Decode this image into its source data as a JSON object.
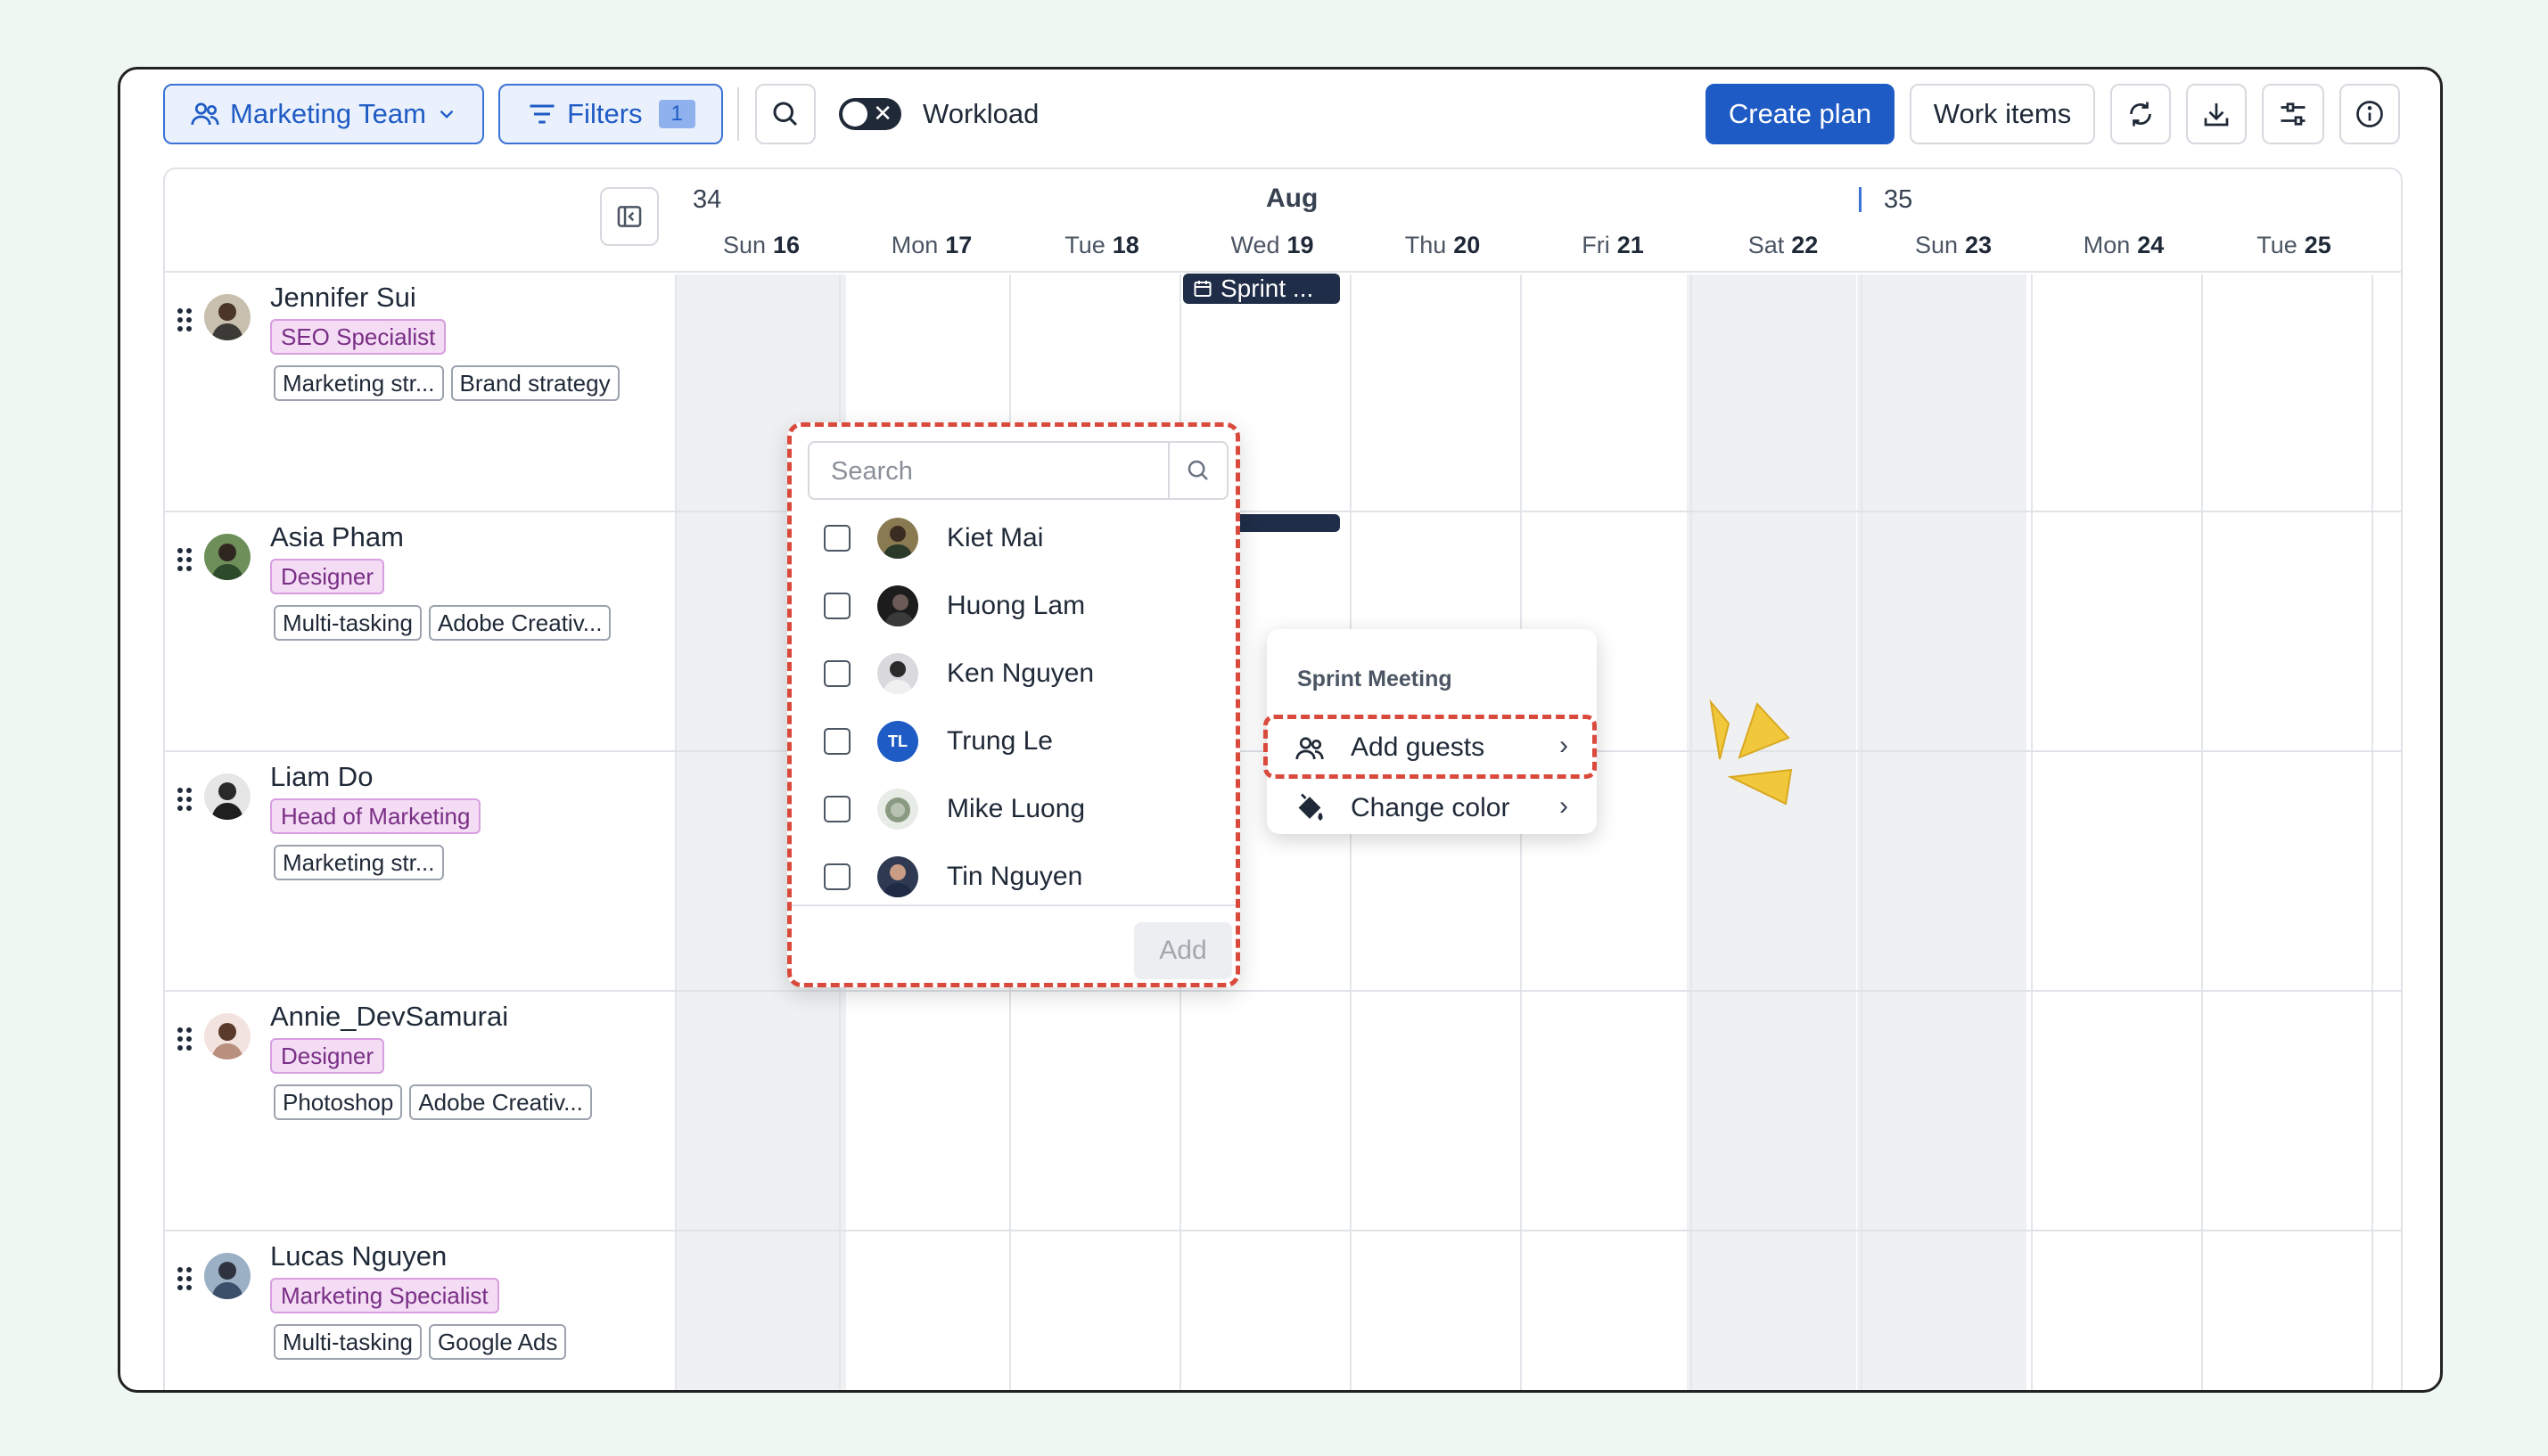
{
  "toolbar": {
    "team_label": "Marketing Team",
    "filters_label": "Filters",
    "filter_count": "1",
    "workload_label": "Workload",
    "create_label": "Create plan",
    "work_items_label": "Work items"
  },
  "calendar": {
    "week_a": "34",
    "week_b": "35",
    "month": "Aug",
    "days": [
      {
        "dow": "Sun",
        "d": "16"
      },
      {
        "dow": "Mon",
        "d": "17"
      },
      {
        "dow": "Tue",
        "d": "18"
      },
      {
        "dow": "Wed",
        "d": "19"
      },
      {
        "dow": "Thu",
        "d": "20"
      },
      {
        "dow": "Fri",
        "d": "21"
      },
      {
        "dow": "Sat",
        "d": "22"
      },
      {
        "dow": "Sun",
        "d": "23"
      },
      {
        "dow": "Mon",
        "d": "24"
      },
      {
        "dow": "Tue",
        "d": "25"
      }
    ],
    "event_label": "Sprint ..."
  },
  "people": [
    {
      "name": "Jennifer Sui",
      "role": "SEO Specialist",
      "tags": [
        "Marketing str...",
        "Brand strategy"
      ]
    },
    {
      "name": "Asia Pham",
      "role": "Designer",
      "tags": [
        "Multi-tasking",
        "Adobe Creativ..."
      ]
    },
    {
      "name": "Liam Do",
      "role": "Head of Marketing",
      "tags": [
        "Marketing str..."
      ]
    },
    {
      "name": "Annie_DevSamurai",
      "role": "Designer",
      "tags": [
        "Photoshop",
        "Adobe Creativ..."
      ]
    },
    {
      "name": "Lucas Nguyen",
      "role": "Marketing Specialist",
      "tags": [
        "Multi-tasking",
        "Google Ads"
      ]
    }
  ],
  "guest_picker": {
    "search_placeholder": "Search",
    "add_label": "Add",
    "options": [
      {
        "name": "Kiet Mai",
        "checked": false
      },
      {
        "name": "Huong Lam",
        "checked": false
      },
      {
        "name": "Ken Nguyen",
        "checked": false
      },
      {
        "name": "Trung Le",
        "checked": false,
        "initials": "TL"
      },
      {
        "name": "Mike Luong",
        "checked": false
      },
      {
        "name": "Tin Nguyen",
        "checked": false
      }
    ]
  },
  "context_menu": {
    "title": "Sprint Meeting",
    "add_guests": "Add guests",
    "change_color": "Change color"
  },
  "colors": {
    "accent": "#1f5bc4",
    "highlight": "#d94a3d",
    "role_bg": "#f3dcf4",
    "weekend": "#eef0f2",
    "event": "#1f2d48",
    "sparkle": "#f1c83c"
  }
}
